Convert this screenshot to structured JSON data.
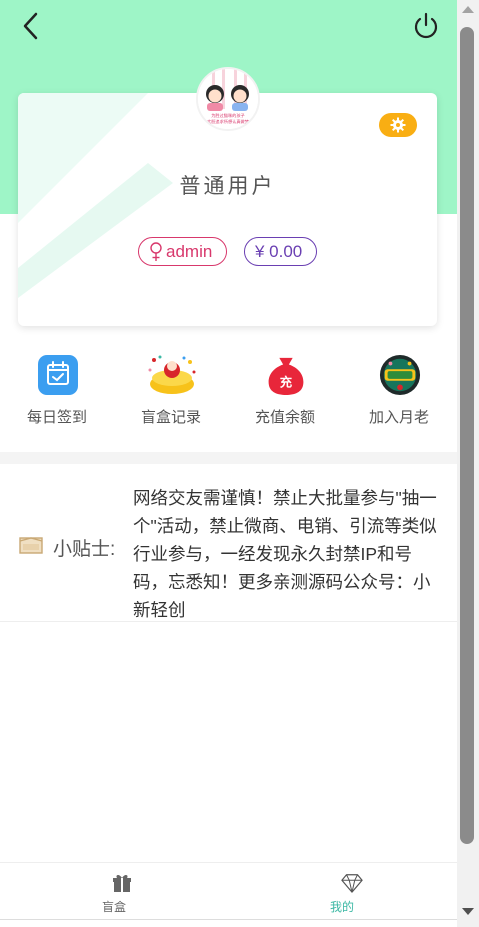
{
  "header": {
    "back_icon": "chevron-left-icon",
    "power_icon": "power-icon"
  },
  "profile": {
    "avatar_icon": "avatar-illustration",
    "avatar_caption_line1": "为胜过猫咪的孩子",
    "avatar_caption_line2": "大胆追求所想认真做梦",
    "settings_icon": "gear-icon",
    "title": "普通用户",
    "gender_icon": "female-symbol-icon",
    "username": "admin",
    "balance": "¥ 0.00"
  },
  "shortcuts": [
    {
      "label": "每日签到",
      "icon": "calendar-check-icon"
    },
    {
      "label": "盲盒记录",
      "icon": "blind-box-icon"
    },
    {
      "label": "充值余额",
      "icon": "recharge-bag-icon"
    },
    {
      "label": "加入月老",
      "icon": "matchmaker-badge-icon"
    }
  ],
  "notice": {
    "icon": "envelope-icon",
    "label": "小贴士:",
    "text": "网络交友需谨慎！禁止大批量参与\"抽一个\"活动，禁止微商、电销、引流等类似行业参与，一经发现永久封禁IP和号码，忘悉知！更多亲测源码公众号：小新轻创"
  },
  "tabbar": [
    {
      "label": "盲盒",
      "icon": "gift-icon",
      "active": false
    },
    {
      "label": "我的",
      "icon": "diamond-icon",
      "active": true
    }
  ],
  "colors": {
    "hero": "#9ef5c7",
    "accent": "#3bb8a4",
    "settings": "#f9ae13",
    "username": "#d8386c",
    "balance": "#6a3fb2"
  }
}
